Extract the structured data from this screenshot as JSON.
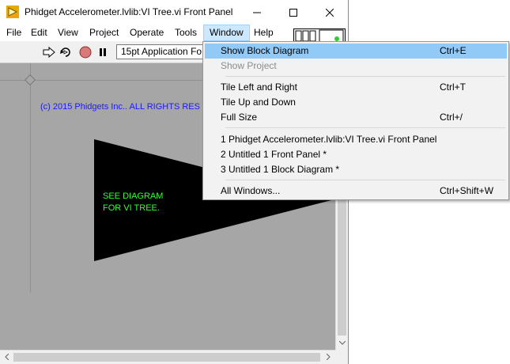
{
  "window": {
    "title": "Phidget Accelerometer.lvlib:VI Tree.vi Front Panel",
    "buttons": {
      "minimize": "minimize",
      "maximize": "maximize",
      "close": "close"
    }
  },
  "menubar": [
    "File",
    "Edit",
    "View",
    "Project",
    "Operate",
    "Tools",
    "Window",
    "Help"
  ],
  "toolbar": {
    "font_select": "15pt Application Fo",
    "icons": [
      "run-arrow-icon",
      "run-continuously-icon",
      "abort-icon",
      "pause-icon"
    ]
  },
  "panel": {
    "copyright": "(c) 2015 Phidgets Inc..  ALL RIGHTS RES",
    "triangle_text": "SEE DIAGRAM\nFOR VI TREE."
  },
  "window_menu": {
    "items": [
      {
        "label": "Show Block Diagram",
        "shortcut": "Ctrl+E"
      },
      {
        "label": "Show Project",
        "shortcut": ""
      },
      {
        "label": "Tile Left and Right",
        "shortcut": "Ctrl+T"
      },
      {
        "label": "Tile Up and Down",
        "shortcut": ""
      },
      {
        "label": "Full Size",
        "shortcut": "Ctrl+/"
      },
      {
        "label": "1 Phidget Accelerometer.lvlib:VI Tree.vi Front Panel",
        "shortcut": ""
      },
      {
        "label": "2 Untitled 1 Front Panel *",
        "shortcut": ""
      },
      {
        "label": "3 Untitled 1 Block Diagram *",
        "shortcut": ""
      },
      {
        "label": "All Windows...",
        "shortcut": "Ctrl+Shift+W"
      }
    ]
  },
  "colors": {
    "highlight": "#91c9f7",
    "panel_bg": "#a6a6a6",
    "copyright_text": "#1a1aff",
    "triangle_text": "#33ff33"
  }
}
